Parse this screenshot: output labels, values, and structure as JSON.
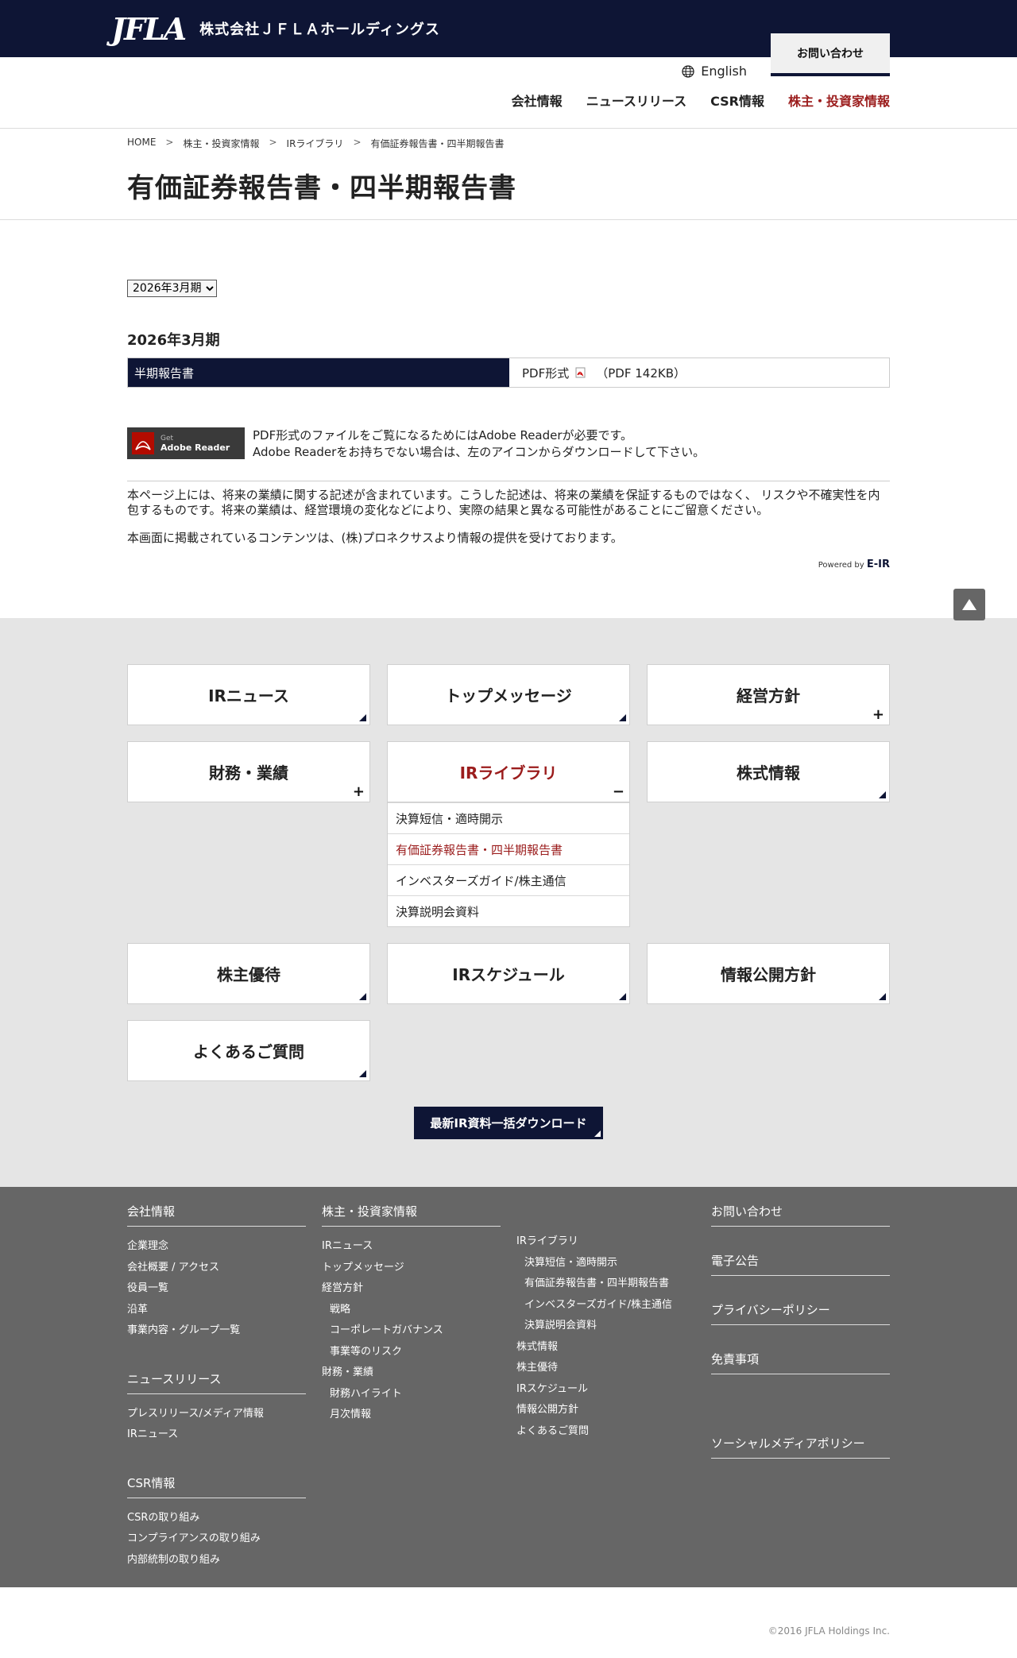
{
  "header": {
    "logo_text": "JFLA",
    "company_name": "株式会社ＪＦＬＡホールディングス",
    "language_link": "English",
    "contact_button": "お問い合わせ",
    "nav": [
      "会社情報",
      "ニュースリリース",
      "CSR情報",
      "株主・投資家情報"
    ]
  },
  "breadcrumb": [
    "HOME",
    "株主・投資家情報",
    "IRライブラリ",
    "有価証券報告書・四半期報告書"
  ],
  "breadcrumb_sep": ">",
  "page_title": "有価証券報告書・四半期報告書",
  "period_select": {
    "selected": "2026年3月期"
  },
  "section_heading": "2026年3月期",
  "report": {
    "name": "半期報告書",
    "format": "PDF形式",
    "size": "（PDF 142KB）"
  },
  "adobe": {
    "badge_small": "Get",
    "badge_big": "Adobe Reader",
    "line1": "PDF形式のファイルをご覧になるためにはAdobe Readerが必要です。",
    "line2": "Adobe Readerをお持ちでない場合は、左のアイコンからダウンロードして下さい。"
  },
  "disclaimer": {
    "p1": "本ページ上には、将来の業績に関する記述が含まれています。こうした記述は、将来の業績を保証するものではなく、 リスクや不確実性を内包するものです。将来の業績は、経営環境の変化などにより、実際の結果と異なる可能性があることにご留意ください。",
    "p2": "本画面に掲載されているコンテンツは、(株)プロネクサスより情報の提供を受けております。"
  },
  "powered_by": {
    "label": "Powered by",
    "brand": "E-IR"
  },
  "tiles": {
    "ir_news": "IRニュース",
    "top_message": "トップメッセージ",
    "policy": "経営方針",
    "finance": "財務・業績",
    "ir_library": "IRライブラリ",
    "stock_info": "株式情報",
    "benefits": "株主優待",
    "schedule": "IRスケジュール",
    "disclosure": "情報公開方針",
    "faq": "よくあるご質問"
  },
  "ir_library_sub": [
    "決算短信・適時開示",
    "有価証券報告書・四半期報告書",
    "インベスターズガイド/株主通信",
    "決算説明会資料"
  ],
  "download_button": "最新IR資料一括ダウンロード",
  "footer": {
    "company": {
      "title": "会社情報",
      "items": [
        "企業理念",
        "会社概要 / アクセス",
        "役員一覧",
        "沿革",
        "事業内容・グループ一覧"
      ]
    },
    "news": {
      "title": "ニュースリリース",
      "items": [
        "プレスリリース/メディア情報",
        "IRニュース"
      ]
    },
    "csr": {
      "title": "CSR情報",
      "items": [
        "CSRの取り組み",
        "コンプライアンスの取り組み",
        "内部統制の取り組み"
      ]
    },
    "ir": {
      "title": "株主・投資家情報",
      "col1": [
        "IRニュース",
        "トップメッセージ",
        "経営方針",
        "戦略",
        "コーポレートガバナンス",
        "事業等のリスク",
        "財務・業績",
        "財務ハイライト",
        "月次情報"
      ],
      "col2": [
        "IRライブラリ",
        "決算短信・適時開示",
        "有価証券報告書・四半期報告書",
        "インベスターズガイド/株主通信",
        "決算説明会資料",
        "株式情報",
        "株主優待",
        "IRスケジュール",
        "情報公開方針",
        "よくあるご質問"
      ]
    },
    "right": [
      "お問い合わせ",
      "電子公告",
      "プライバシーポリシー",
      "免責事項",
      "ソーシャルメディアポリシー"
    ]
  },
  "copyright": "©2016 JFLA Holdings Inc.",
  "colors": {
    "navy": "#0e1535",
    "accent_red": "#9b1c1c",
    "menu_bg": "#e5e5e5",
    "footer_bg": "#666666"
  }
}
